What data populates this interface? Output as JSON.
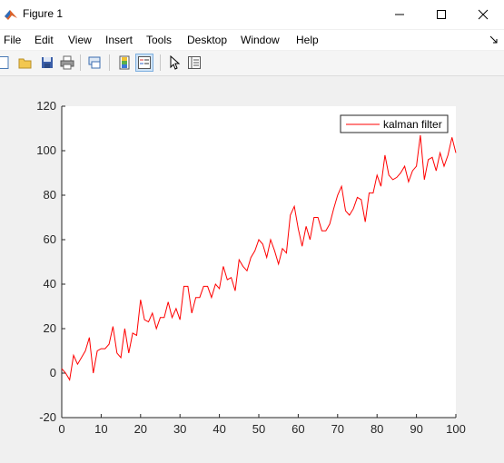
{
  "window": {
    "title": "Figure 1"
  },
  "menu": [
    "File",
    "Edit",
    "View",
    "Insert",
    "Tools",
    "Desktop",
    "Window",
    "Help"
  ],
  "toolbar": {
    "tools": [
      "new-figure-icon",
      "open-file-icon",
      "save-icon",
      "print-icon",
      "link-plot-icon",
      "colorbar-icon",
      "legend-icon",
      "pointer-icon",
      "property-inspector-icon"
    ]
  },
  "colors": {
    "line": "#ff0000",
    "axes_bg": "#ffffff",
    "figure_bg": "#f0f0f0"
  },
  "chart_data": {
    "type": "line",
    "title": "",
    "xlabel": "",
    "ylabel": "",
    "xlim": [
      0,
      100
    ],
    "ylim": [
      -20,
      120
    ],
    "xticks": [
      0,
      10,
      20,
      30,
      40,
      50,
      60,
      70,
      80,
      90,
      100
    ],
    "yticks": [
      -20,
      0,
      20,
      40,
      60,
      80,
      100,
      120
    ],
    "legend_position": "top-right",
    "grid": false,
    "series": [
      {
        "name": "kalman filter",
        "color": "#ff0000",
        "x": [
          0,
          1,
          2,
          3,
          4,
          5,
          6,
          7,
          8,
          9,
          10,
          11,
          12,
          13,
          14,
          15,
          16,
          17,
          18,
          19,
          20,
          21,
          22,
          23,
          24,
          25,
          26,
          27,
          28,
          29,
          30,
          31,
          32,
          33,
          34,
          35,
          36,
          37,
          38,
          39,
          40,
          41,
          42,
          43,
          44,
          45,
          46,
          47,
          48,
          49,
          50,
          51,
          52,
          53,
          54,
          55,
          56,
          57,
          58,
          59,
          60,
          61,
          62,
          63,
          64,
          65,
          66,
          67,
          68,
          69,
          70,
          71,
          72,
          73,
          74,
          75,
          76,
          77,
          78,
          79,
          80,
          81,
          82,
          83,
          84,
          85,
          86,
          87,
          88,
          89,
          90,
          91,
          92,
          93,
          94,
          95,
          96,
          97,
          98,
          99,
          100
        ],
        "values": [
          2,
          0,
          -3,
          8,
          4,
          7,
          10,
          16,
          0,
          10,
          11,
          11,
          13,
          21,
          9,
          7,
          20,
          9,
          18,
          17,
          33,
          24,
          23,
          27,
          20,
          25,
          25,
          32,
          25,
          29,
          24,
          39,
          39,
          27,
          34,
          34,
          39,
          39,
          34,
          40,
          38,
          48,
          42,
          43,
          37,
          51,
          48,
          46,
          52,
          55,
          60,
          58,
          52,
          60,
          55,
          49,
          56,
          54,
          71,
          75,
          65,
          57,
          66,
          60,
          70,
          70,
          64,
          64,
          67,
          74,
          80,
          84,
          73,
          71,
          74,
          79,
          78,
          68,
          81,
          81,
          89,
          84,
          98,
          89,
          87,
          88,
          90,
          93,
          86,
          91,
          93,
          107,
          87,
          96,
          97,
          91,
          99,
          93,
          98,
          106,
          99
        ]
      }
    ]
  }
}
